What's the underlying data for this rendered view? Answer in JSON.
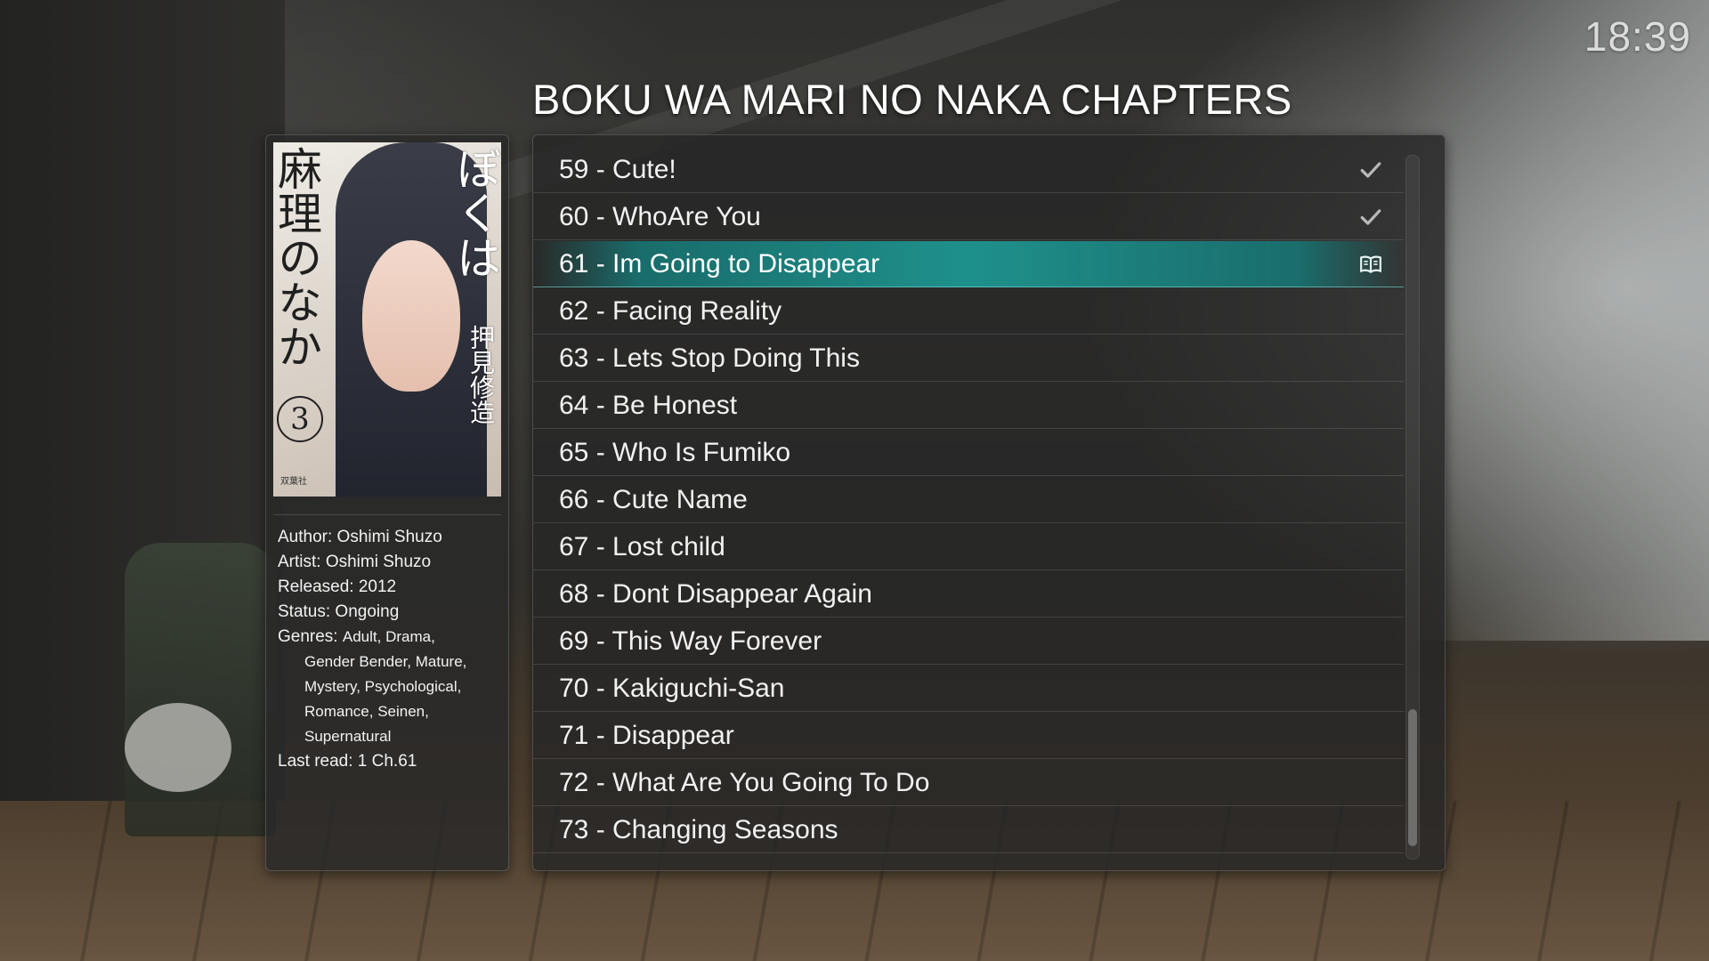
{
  "clock": "18:39",
  "page_title": "BOKU WA MARI NO NAKA CHAPTERS",
  "cover": {
    "title_left": "麻理のなか",
    "title_right": "ぼくは",
    "author": "押見修造",
    "volume": "3",
    "publisher": "双葉社"
  },
  "info": {
    "author": "Author: Oshimi Shuzo",
    "artist": "Artist: Oshimi Shuzo",
    "released": "Released: 2012",
    "status": "Status: Ongoing",
    "genres_label": "Genres:",
    "genres_line1": "Adult, Drama,",
    "genres_line2": "Gender Bender, Mature,",
    "genres_line3": "Mystery, Psychological,",
    "genres_line4": "Romance, Seinen,",
    "genres_line5": "Supernatural",
    "last_read": "Last read: 1 Ch.61"
  },
  "chapters": [
    {
      "label": "59 - Cute!",
      "status": "read-check-icon"
    },
    {
      "label": "60 - WhoAre You",
      "status": "read-check-icon"
    },
    {
      "label": "61 - Im Going to Disappear",
      "status": "open-book-icon",
      "selected": true
    },
    {
      "label": "62 - Facing Reality",
      "status": ""
    },
    {
      "label": "63 - Lets Stop Doing This",
      "status": ""
    },
    {
      "label": "64 - Be Honest",
      "status": ""
    },
    {
      "label": "65 - Who Is Fumiko",
      "status": ""
    },
    {
      "label": "66 - Cute Name",
      "status": ""
    },
    {
      "label": "67 - Lost child",
      "status": ""
    },
    {
      "label": "68 - Dont Disappear Again",
      "status": ""
    },
    {
      "label": "69 - This Way Forever",
      "status": ""
    },
    {
      "label": "70 - Kakiguchi-San",
      "status": ""
    },
    {
      "label": "71 - Disappear",
      "status": ""
    },
    {
      "label": "72 - What Are You Going To Do",
      "status": ""
    },
    {
      "label": "73 - Changing Seasons",
      "status": ""
    }
  ],
  "colors": {
    "selection_accent": "#1e9691",
    "panel_bg": "#262626"
  }
}
